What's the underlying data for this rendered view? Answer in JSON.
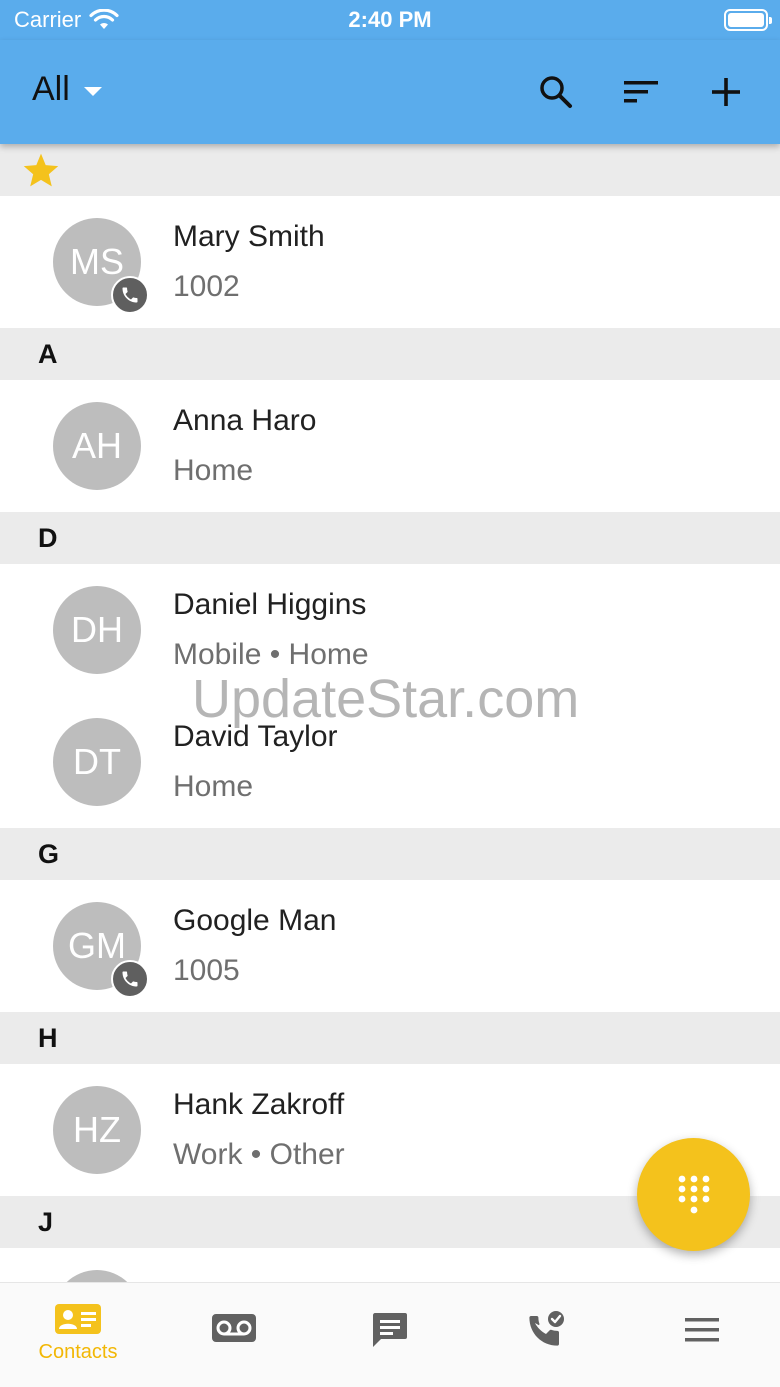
{
  "status_bar": {
    "carrier": "Carrier",
    "time": "2:40 PM"
  },
  "header": {
    "filter_label": "All"
  },
  "sections": [
    {
      "title": "",
      "favorite": true,
      "contacts": [
        {
          "initials": "MS",
          "name": "Mary Smith",
          "detail": "1002",
          "has_phone_badge": true
        }
      ]
    },
    {
      "title": "A",
      "contacts": [
        {
          "initials": "AH",
          "name": "Anna Haro",
          "detail": "Home",
          "has_phone_badge": false
        }
      ]
    },
    {
      "title": "D",
      "contacts": [
        {
          "initials": "DH",
          "name": "Daniel Higgins",
          "detail": "Mobile • Home",
          "has_phone_badge": false
        },
        {
          "initials": "DT",
          "name": "David Taylor",
          "detail": "Home",
          "has_phone_badge": false
        }
      ]
    },
    {
      "title": "G",
      "contacts": [
        {
          "initials": "GM",
          "name": "Google Man",
          "detail": "1005",
          "has_phone_badge": true
        }
      ]
    },
    {
      "title": "H",
      "contacts": [
        {
          "initials": "HZ",
          "name": "Hank Zakroff",
          "detail": "Work • Other",
          "has_phone_badge": false
        }
      ]
    },
    {
      "title": "J",
      "contacts": []
    }
  ],
  "watermark": "UpdateStar.com",
  "bottom_nav": [
    {
      "icon": "contacts-card-icon",
      "label": "Contacts",
      "active": true
    },
    {
      "icon": "voicemail-icon",
      "label": "",
      "active": false
    },
    {
      "icon": "chat-icon",
      "label": "",
      "active": false
    },
    {
      "icon": "call-history-icon",
      "label": "",
      "active": false
    },
    {
      "icon": "menu-icon",
      "label": "",
      "active": false
    }
  ],
  "colors": {
    "primary": "#5aacec",
    "accent": "#f4c21c",
    "avatar": "#bdbdbd",
    "section_bg": "#ebebeb",
    "inactive_icon": "#616161"
  }
}
